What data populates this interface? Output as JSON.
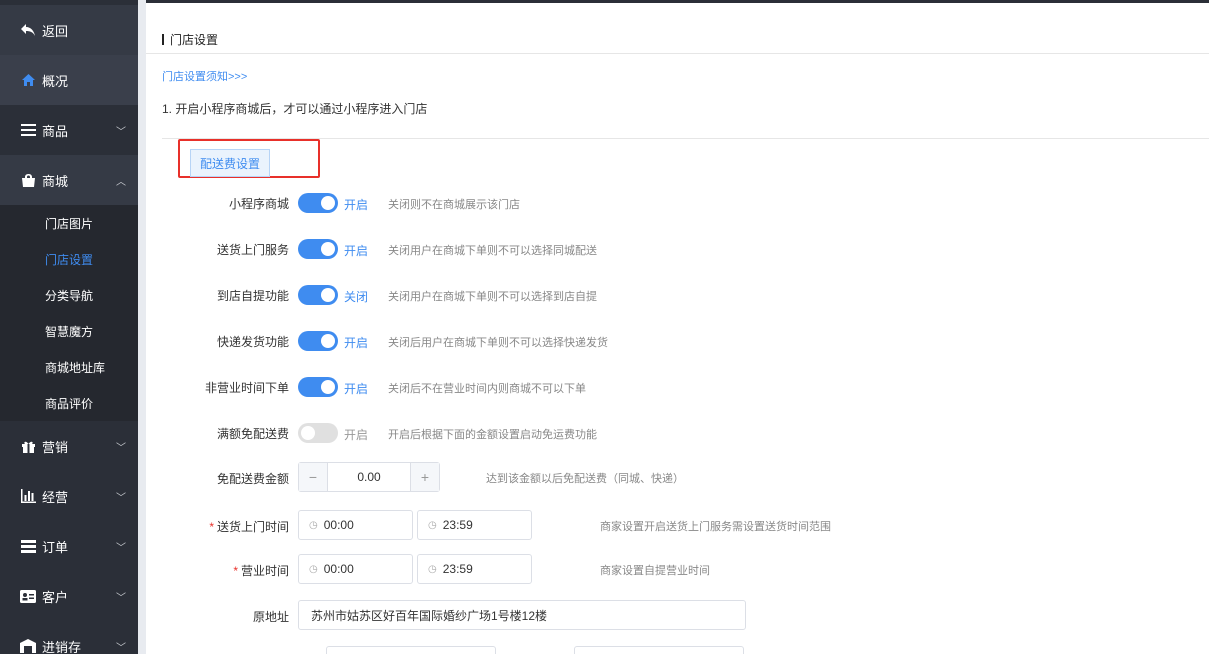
{
  "sidebar": {
    "back": "返回",
    "overview": "概况",
    "goods": "商品",
    "mall": "商城",
    "mall_sub": [
      "门店图片",
      "门店设置",
      "分类导航",
      "智慧魔方",
      "商城地址库",
      "商品评价"
    ],
    "marketing": "营销",
    "operation": "经营",
    "orders": "订单",
    "customers": "客户",
    "inventory": "进销存"
  },
  "header": {
    "title": "门店设置"
  },
  "notice": {
    "link": "门店设置须知>>>",
    "text": "1. 开启小程序商城后，才可以通过小程序进入门店"
  },
  "tab": {
    "label": "配送费设置"
  },
  "settings": [
    {
      "label": "小程序商城",
      "on": true,
      "state": "开启",
      "hint": "关闭则不在商城展示该门店"
    },
    {
      "label": "送货上门服务",
      "on": true,
      "state": "开启",
      "hint": "关闭用户在商城下单则不可以选择同城配送"
    },
    {
      "label": "到店自提功能",
      "on": true,
      "state": "关闭",
      "hint": "关闭用户在商城下单则不可以选择到店自提"
    },
    {
      "label": "快递发货功能",
      "on": true,
      "state": "开启",
      "hint": "关闭后用户在商城下单则不可以选择快递发货"
    },
    {
      "label": "非营业时间下单",
      "on": true,
      "state": "开启",
      "hint": "关闭后不在营业时间内则商城不可以下单"
    },
    {
      "label": "满额免配送费",
      "on": false,
      "state": "开启",
      "hint": "开启后根据下面的金额设置启动免运费功能"
    }
  ],
  "free_amount": {
    "label": "免配送费金额",
    "minus": "−",
    "value": "0.00",
    "plus": "+",
    "hint": "达到该金额以后免配送费（同城、快递）"
  },
  "delivery_time": {
    "required": "*",
    "label": "送货上门时间",
    "start": "00:00",
    "end": "23:59",
    "hint": "商家设置开启送货上门服务需设置送货时间范围"
  },
  "business_time": {
    "required": "*",
    "label": "营业时间",
    "start": "00:00",
    "end": "23:59",
    "hint": "商家设置自提营业时间"
  },
  "address": {
    "label": "原地址",
    "value": "苏州市姑苏区好百年国际婚纱广场1号楼12楼"
  },
  "icons": {
    "clock": "clock-icon"
  },
  "colors": {
    "accent": "#3f8cf0",
    "sidebar": "#2b2f38",
    "highlight": "#e8302a"
  }
}
